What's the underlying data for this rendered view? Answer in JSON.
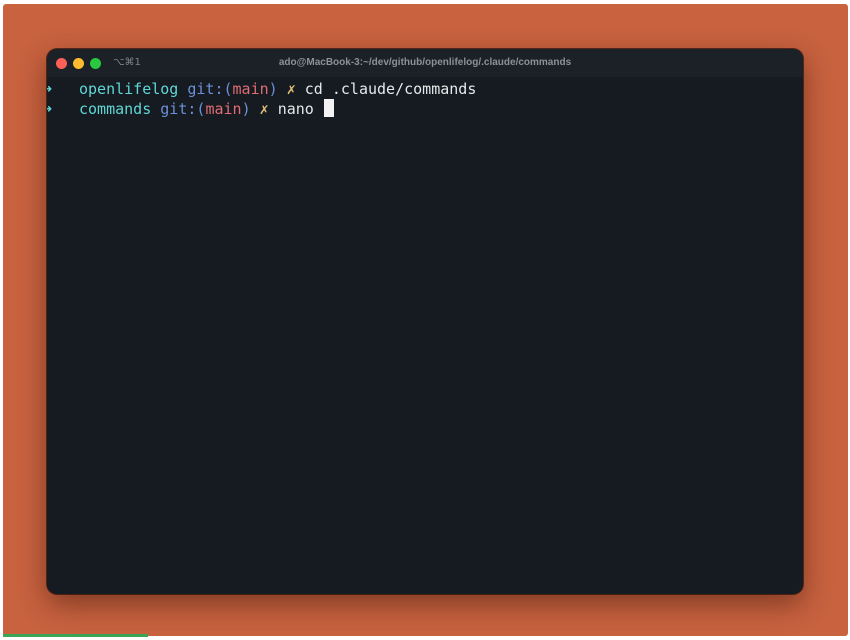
{
  "window": {
    "title": "ado@MacBook-3:~/dev/github/openlifelog/.claude/commands",
    "shortcut": "⌥⌘1"
  },
  "terminal": {
    "prompt_symbol": "➜",
    "lines": [
      {
        "dir": "openlifelog",
        "git_open": "git:(",
        "branch": "main",
        "git_close": ")",
        "dirty_mark": "✗",
        "command": "cd .claude/commands"
      },
      {
        "dir": "commands",
        "git_open": "git:(",
        "branch": "main",
        "git_close": ")",
        "dirty_mark": "✗",
        "command": "nano"
      }
    ]
  },
  "colors": {
    "backdrop": "#c8623f",
    "terminal_bg": "#151b20",
    "directory": "#5fd7d7",
    "git_label": "#6d8fd8",
    "branch": "#e06c75",
    "dirty_mark": "#e5c07b",
    "text": "#e6e8ea"
  }
}
